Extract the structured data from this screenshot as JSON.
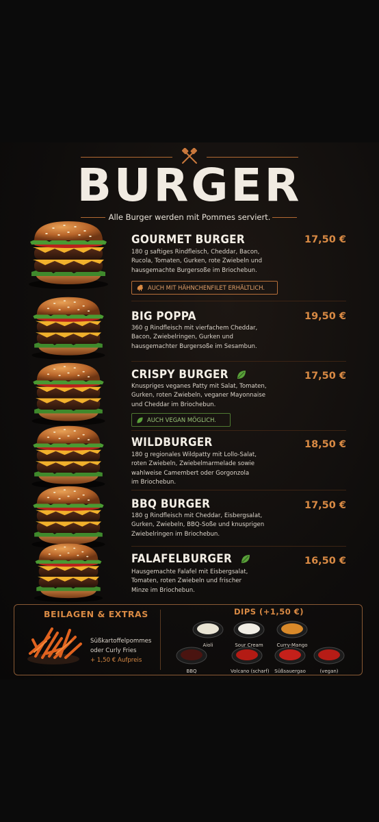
{
  "header": {
    "title": "BURGER",
    "subtitle": "Alle Burger werden mit Pommes serviert."
  },
  "items": [
    {
      "name": "GOURMET BURGER",
      "price": "17,50 €",
      "desc1": "180 g saftiges Rindfleisch, Cheddar, Bacon,",
      "desc2": "Rucola, Tomaten, Gurken, rote Zwiebeln und",
      "desc3": "hausgemachte Burgersoße im Briochebun.",
      "tag": "AUCH MIT HÄHNCHENFILET ERHÄLTLICH."
    },
    {
      "name": "BIG POPPA",
      "price": "19,50 €",
      "desc1": "360 g Rindfleisch mit vierfachem Cheddar,",
      "desc2": "Bacon, Zwiebelringen, Gurken und",
      "desc3": "hausgemachter Burgersoße im Sesambun."
    },
    {
      "name": "CRISPY BURGER",
      "price": "17,50 €",
      "desc1": "Knuspriges veganes Patty mit Salat, Tomaten,",
      "desc2": "Gurken, roten Zwiebeln, veganer Mayonnaise",
      "desc3": "und Cheddar im Briochebun.",
      "tag": "AUCH VEGAN MÖGLICH."
    },
    {
      "name": "WILDBURGER",
      "price": "18,50 €",
      "desc1": "180 g regionales Wildpatty mit Lollo-Salat,",
      "desc2": "roten Zwiebeln, Zwiebelmarmelade sowie",
      "desc3": "wahlweise Camembert oder Gorgonzola",
      "desc4": "im Briochebun."
    },
    {
      "name": "BBQ BURGER",
      "price": "17,50 €",
      "desc1": "180 g Rindfleisch mit Cheddar, Eisbergsalat,",
      "desc2": "Gurken, Zwiebeln, BBQ-Soße und knusprigen",
      "desc3": "Zwiebelringen im Briochebun."
    },
    {
      "name": "FALAFELBURGER",
      "price": "16,50 €",
      "desc1": "Hausgemachte Falafel mit Eisbergsalat,",
      "desc2": "Tomaten, roten Zwiebeln und frischer",
      "desc3": "Minze im Briochebun."
    }
  ],
  "extras": {
    "title": "BEILAGEN & EXTRAS",
    "line1": "Süßkartoffelpommes",
    "line2": "oder Curly Fries",
    "line3": "+ 1,50 € Aufpreis"
  },
  "dips": {
    "title": "DIPS (+1,50 €)",
    "list": [
      {
        "label": "Aioli",
        "color": "#e9e4d4"
      },
      {
        "label": "Sour Cream",
        "color": "#f0ede4"
      },
      {
        "label": "Curry-Mango",
        "color": "#d8892a"
      },
      {
        "label": "BBQ",
        "color": "#4a1410"
      },
      {
        "label": "Volcano (scharf)",
        "color": "#b31b14"
      },
      {
        "label": "Süßsauergao",
        "color": "#c4201a"
      },
      {
        "label": "(vegan)",
        "color": "#b61c16"
      }
    ]
  }
}
